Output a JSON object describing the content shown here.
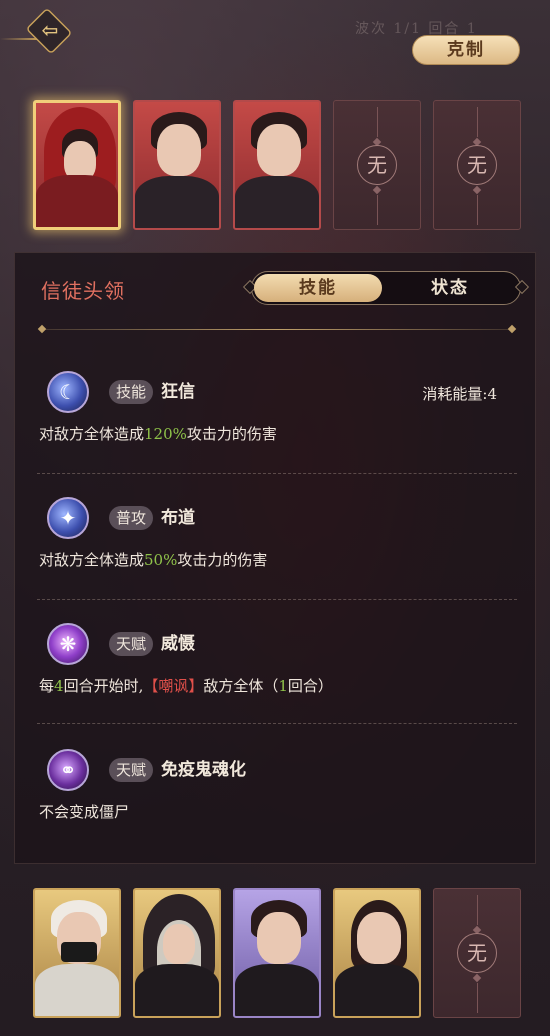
{
  "header": {
    "faint_text": "波次  1/1  回合 1",
    "restraint_button": "克制"
  },
  "enemy_team": [
    {
      "type": "portrait",
      "selected": true,
      "style": "hooded"
    },
    {
      "type": "portrait",
      "selected": false,
      "style": "topknot"
    },
    {
      "type": "portrait",
      "selected": false,
      "style": "topknot"
    },
    {
      "type": "empty",
      "label": "无"
    },
    {
      "type": "empty",
      "label": "无"
    }
  ],
  "panel": {
    "title": "信徒头领",
    "tabs": [
      {
        "label": "技能",
        "active": true
      },
      {
        "label": "状态",
        "active": false
      }
    ],
    "skills": [
      {
        "icon": "crescent-moon-icon",
        "tag": "技能",
        "name": "狂信",
        "cost": "消耗能量:4",
        "desc_pre": "对敌方全体造成",
        "desc_hl": "120%",
        "desc_post": "攻击力的伤害"
      },
      {
        "icon": "crescent-slash-icon",
        "tag": "普攻",
        "name": "布道",
        "cost": "",
        "desc_pre": "对敌方全体造成",
        "desc_hl": "50%",
        "desc_post": "攻击力的伤害"
      },
      {
        "icon": "vortex-icon",
        "tag": "天赋",
        "name": "威慑",
        "cost": "",
        "desc_a": "每",
        "desc_num1": "4",
        "desc_b": "回合开始时,",
        "desc_status": "【嘲讽】",
        "desc_c": "敌方全体（",
        "desc_num2": "1",
        "desc_d": "回合）"
      },
      {
        "icon": "chain-icon",
        "tag": "天赋",
        "name": "免疫鬼魂化",
        "cost": "",
        "desc": "不会变成僵尸"
      }
    ]
  },
  "player_team": [
    {
      "type": "gold",
      "style": "white-masked"
    },
    {
      "type": "gold",
      "style": "silver-hooded"
    },
    {
      "type": "purple",
      "style": "dark-topknot"
    },
    {
      "type": "gold",
      "style": "black-long-hair"
    },
    {
      "type": "empty",
      "label": "无"
    }
  ]
}
